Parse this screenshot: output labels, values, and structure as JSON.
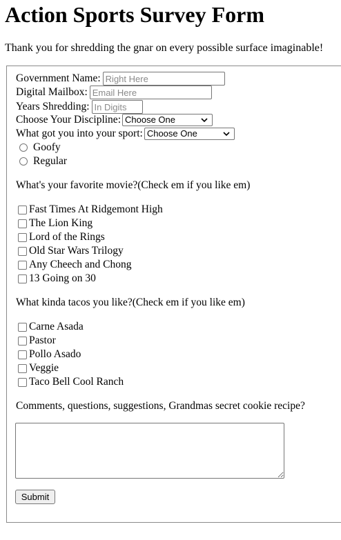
{
  "page": {
    "title": "Action Sports Survey Form",
    "intro": "Thank you for shredding the gnar on every possible surface imaginable!"
  },
  "form": {
    "name": {
      "label": "Government Name:",
      "placeholder": "Right Here"
    },
    "email": {
      "label": "Digital Mailbox:",
      "placeholder": "Email Here"
    },
    "years": {
      "label": "Years Shredding:",
      "placeholder": "In Digits"
    },
    "discipline": {
      "label": "Choose Your Discipline:",
      "selected": "Choose One"
    },
    "origin": {
      "label": "What got you into your sport:",
      "selected": "Choose One"
    },
    "stance": [
      {
        "label": "Goofy"
      },
      {
        "label": "Regular"
      }
    ],
    "movies": {
      "question": "What's your favorite movie?(Check em if you like em)",
      "options": [
        "Fast Times At Ridgemont High",
        "The Lion King",
        "Lord of the Rings",
        "Old Star Wars Trilogy",
        "Any Cheech and Chong",
        "13 Going on 30"
      ]
    },
    "tacos": {
      "question": "What kinda tacos you like?(Check em if you like em)",
      "options": [
        "Carne Asada",
        "Pastor",
        "Pollo Asado",
        "Veggie",
        "Taco Bell Cool Ranch"
      ]
    },
    "comments": {
      "label": "Comments, questions, suggestions, Grandmas secret cookie recipe?"
    },
    "submit_label": "Submit"
  }
}
